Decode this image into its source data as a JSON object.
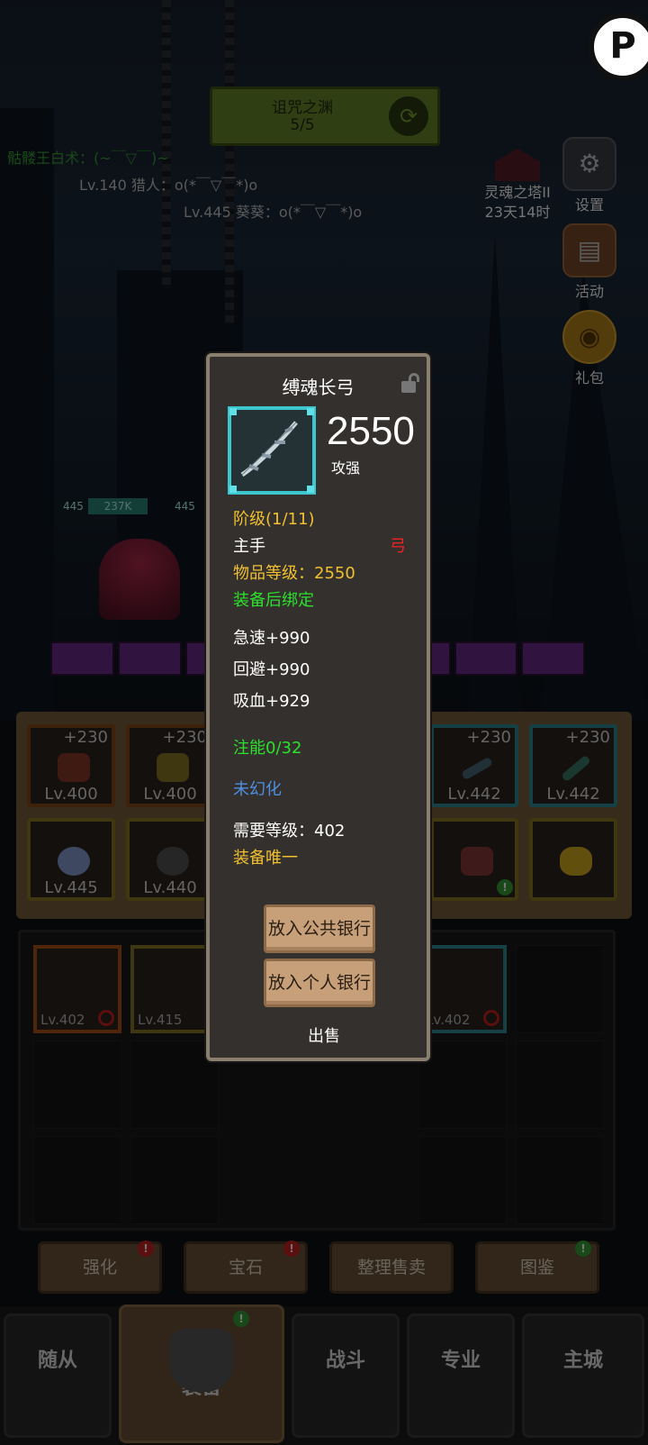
{
  "dungeon": {
    "name": "诅咒之渊",
    "progress": "5/5"
  },
  "chat": [
    {
      "text": "骷髅王白术：(~￣▽￣)~"
    },
    {
      "text": "Lv.140 猎人：o(*￣▽￣*)o"
    },
    {
      "text": "Lv.445 葵葵：o(*￣▽￣*)o"
    }
  ],
  "tower": {
    "name": "灵魂之塔II",
    "timer": "23天14时"
  },
  "side_buttons": {
    "settings": "设置",
    "events": "活动",
    "gift": "礼包"
  },
  "hp": {
    "level": "445",
    "value": "237K",
    "level2": "445"
  },
  "equip_slots": [
    {
      "plus": "+230",
      "level": "Lv.400"
    },
    {
      "plus": "+230",
      "level": "Lv.400"
    },
    {
      "plus": "+230",
      "level": "Lv.442"
    },
    {
      "plus": "+230",
      "level": "Lv.442"
    },
    {
      "level": "Lv.445"
    },
    {
      "level": "Lv.440"
    }
  ],
  "bag_items": [
    {
      "level": "Lv.402"
    },
    {
      "level": "Lv.415"
    },
    {
      "level": "Lv.402"
    }
  ],
  "actions": {
    "enhance": "强化",
    "gem": "宝石",
    "sort_sell": "整理售卖",
    "codex": "图鉴"
  },
  "nav": {
    "followers": "随从",
    "equipment": "装备",
    "battle": "战斗",
    "profession": "专业",
    "main_city": "主城"
  },
  "item": {
    "name": "缚魂长弓",
    "score": "2550",
    "score_label": "攻强",
    "tier": "阶级(1/11)",
    "slot": "主手",
    "type": "弓",
    "item_level": "物品等级：2550",
    "bind": "装备后绑定",
    "stats": [
      "急速+990",
      "回避+990",
      "吸血+929"
    ],
    "infuse": "注能0/32",
    "transmog": "未幻化",
    "required_level": "需要等级：402",
    "unique": "装备唯一",
    "btn_public_bank": "放入公共银行",
    "btn_personal_bank": "放入个人银行",
    "btn_sell": "出售"
  },
  "colors": {
    "accent_yellow": "#f0c030",
    "accent_green": "#2ee02e",
    "accent_blue": "#4e8fe0",
    "accent_red": "#e22222",
    "frame_cyan": "#3ec6cf"
  }
}
